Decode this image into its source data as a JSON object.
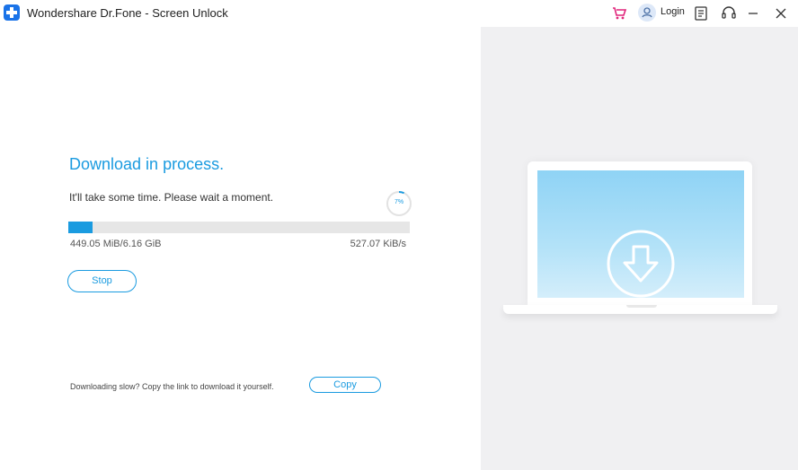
{
  "window": {
    "title": "Wondershare Dr.Fone - Screen Unlock",
    "login_label": "Login"
  },
  "icons": {
    "app": "drfone-logo-icon",
    "cart": "shopping-cart-icon",
    "user": "user-avatar-icon",
    "feedback": "notes-icon",
    "support": "headset-icon",
    "minimize": "minimize-icon",
    "close": "close-icon",
    "download": "download-arrow-icon"
  },
  "colors": {
    "accent": "#1a9be0",
    "cart": "#e0237a",
    "panel_bg": "#f0f0f2"
  },
  "download": {
    "heading": "Download in process.",
    "subtext": "It'll take some time. Please wait a moment.",
    "percent_label": "7%",
    "percent": 7,
    "size_label": "449.05 MiB/6.16 GiB",
    "speed_label": "527.07 KiB/s",
    "stop_label": "Stop"
  },
  "footer": {
    "slow_text": "Downloading slow? Copy the link to download it yourself.",
    "copy_label": "Copy"
  }
}
